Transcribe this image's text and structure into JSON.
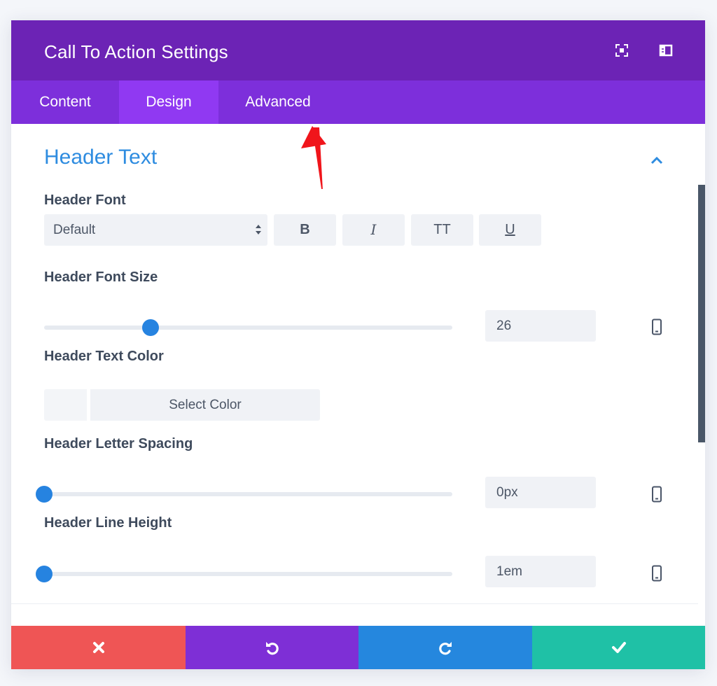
{
  "header": {
    "title": "Call To Action Settings",
    "icons": [
      "expand-icon",
      "sidebar-layout-icon"
    ]
  },
  "tabs": [
    {
      "label": "Content",
      "active": false
    },
    {
      "label": "Design",
      "active": true
    },
    {
      "label": "Advanced",
      "active": false
    }
  ],
  "section": {
    "title": "Header Text",
    "collapse_icon": "chevron-up-icon"
  },
  "fields": {
    "header_font": {
      "label": "Header Font",
      "value": "Default",
      "buttons": [
        "B",
        "I",
        "TT",
        "U"
      ]
    },
    "header_font_size": {
      "label": "Header Font Size",
      "value": "26",
      "slider_fraction": 0.26
    },
    "header_text_color": {
      "label": "Header Text Color",
      "button_label": "Select Color"
    },
    "header_letter_spacing": {
      "label": "Header Letter Spacing",
      "value": "0px",
      "slider_fraction": 0
    },
    "header_line_height": {
      "label": "Header Line Height",
      "value": "1em",
      "slider_fraction": 0
    }
  },
  "footer": {
    "buttons": [
      {
        "name": "discard",
        "icon": "close-icon",
        "color": "#ef5555"
      },
      {
        "name": "undo",
        "icon": "undo-icon",
        "color": "#7e2fd6"
      },
      {
        "name": "redo",
        "icon": "redo-icon",
        "color": "#2587de"
      },
      {
        "name": "save",
        "icon": "check-icon",
        "color": "#1fc1a6"
      }
    ]
  },
  "colors": {
    "header_bg": "#6c23b5",
    "tabs_bg": "#7d2fdb",
    "active_tab_bg": "#9039f2",
    "section_title": "#2e8ce0",
    "slider_thumb": "#2683e0",
    "annotation_arrow": "#f0151b"
  }
}
